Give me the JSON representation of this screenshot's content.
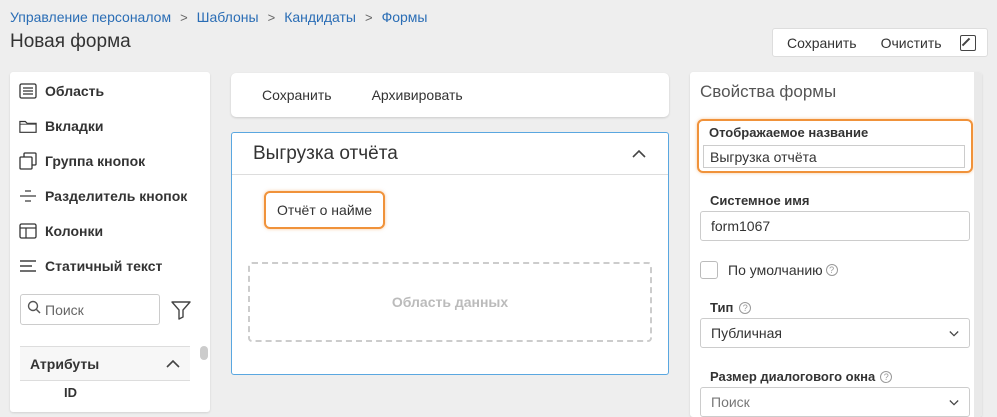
{
  "breadcrumb": {
    "items": [
      "Управление персоналом",
      "Шаблоны",
      "Кандидаты",
      "Формы"
    ]
  },
  "page_title": "Новая форма",
  "top_actions": {
    "save": "Сохранить",
    "clear": "Очистить",
    "edit_icon": "edit-icon"
  },
  "toolbox": {
    "items": [
      {
        "label": "Область",
        "icon": "list-icon"
      },
      {
        "label": "Вкладки",
        "icon": "folder-icon"
      },
      {
        "label": "Группа кнопок",
        "icon": "copy-icon"
      },
      {
        "label": "Разделитель кнопок",
        "icon": "separator-icon"
      },
      {
        "label": "Колонки",
        "icon": "columns-icon"
      },
      {
        "label": "Статичный текст",
        "icon": "text-lines-icon"
      }
    ],
    "search_placeholder": "Поиск",
    "attributes_title": "Атрибуты",
    "attribute_first": "ID"
  },
  "center_toolbar": {
    "save": "Сохранить",
    "archive": "Архивировать"
  },
  "form_card": {
    "title": "Выгрузка отчёта",
    "report_button": "Отчёт о найме",
    "data_area": "Область данных"
  },
  "properties": {
    "title": "Свойства формы",
    "display_name_label": "Отображаемое название",
    "display_name_value": "Выгрузка отчёта",
    "system_name_label": "Системное имя",
    "system_name_value": "form1067",
    "default_label": "По умолчанию",
    "type_label": "Тип",
    "type_value": "Публичная",
    "dialog_size_label": "Размер диалогового окна",
    "dialog_size_placeholder": "Поиск"
  },
  "colors": {
    "link": "#2a6db5",
    "highlight": "#f0923a",
    "card_border": "#5aa7e0"
  }
}
